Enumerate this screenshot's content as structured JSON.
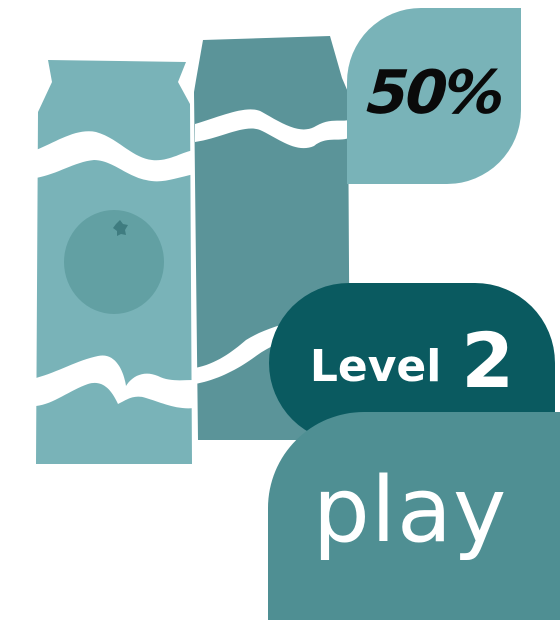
{
  "progress": {
    "value_percent": 50,
    "label": "50%"
  },
  "level": {
    "word": "Level",
    "number": "2"
  },
  "play_button": {
    "label": "play"
  },
  "colors": {
    "carton_light": "#79b3b8",
    "carton_dark": "#5b9499",
    "orange_fruit": "#62a0a3",
    "badge_dark": "#0a5a60",
    "play_teal": "#4f8f93",
    "text_dark": "#0a0a0a",
    "text_light": "#ffffff"
  },
  "icons": {
    "left_carton": "juice-carton-orange-icon",
    "right_carton": "juice-carton-icon",
    "fruit": "orange-fruit-icon"
  }
}
